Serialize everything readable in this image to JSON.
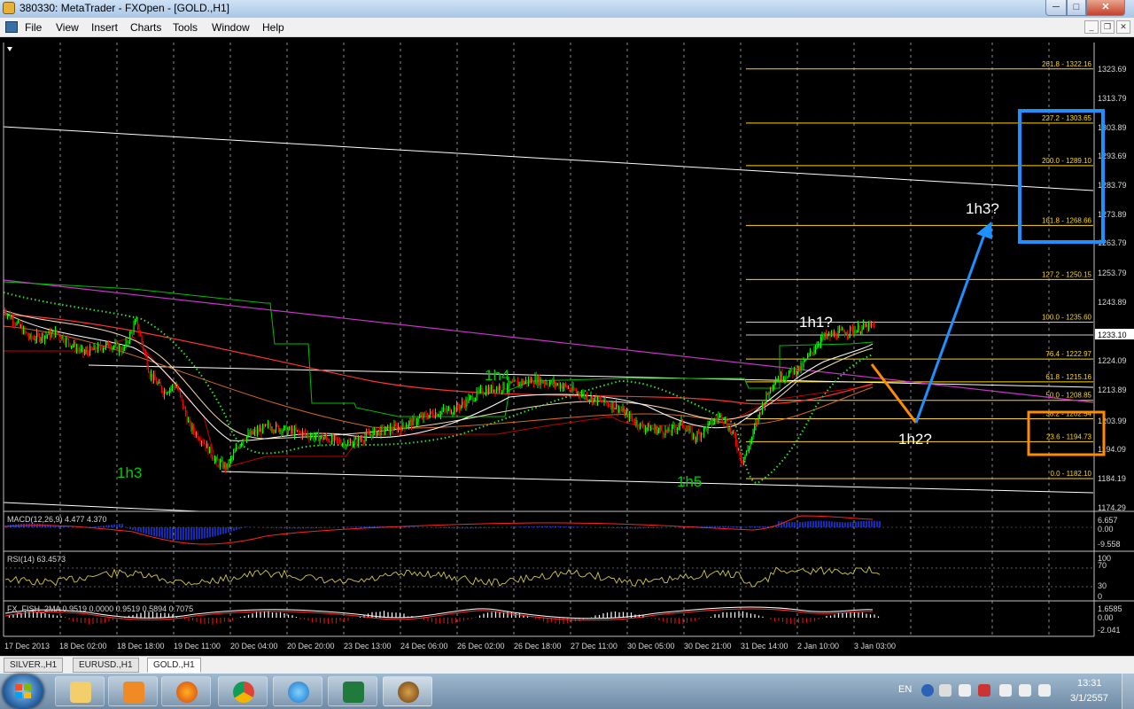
{
  "window": {
    "title": "380330: MetaTrader - FXOpen - [GOLD.,H1]",
    "min_glyph": "─",
    "max_glyph": "□",
    "close_glyph": "✕"
  },
  "menu": [
    "File",
    "View",
    "Insert",
    "Charts",
    "Tools",
    "Window",
    "Help"
  ],
  "mdi": {
    "min": "_",
    "restore": "❐",
    "close": "✕"
  },
  "chart_data": {
    "type": "candlestick",
    "symbol": "GOLD.,H1",
    "price_axis": [
      "1323.69",
      "1313.79",
      "1303.89",
      "1293.69",
      "1283.79",
      "1273.89",
      "1263.79",
      "1253.79",
      "1243.89",
      "1233.10",
      "1224.09",
      "1213.89",
      "1203.99",
      "1194.09",
      "1184.19",
      "1174.29"
    ],
    "current_price": "1233.10",
    "time_axis": [
      "17 Dec 2013",
      "18 Dec 02:00",
      "18 Dec 18:00",
      "19 Dec 11:00",
      "20 Dec 04:00",
      "20 Dec 20:00",
      "23 Dec 13:00",
      "24 Dec 06:00",
      "26 Dec 02:00",
      "26 Dec 18:00",
      "27 Dec 11:00",
      "30 Dec 05:00",
      "30 Dec 21:00",
      "31 Dec 14:00",
      "2 Jan 10:00",
      "3 Jan 03:00"
    ],
    "fibonacci": [
      {
        "label": "261.8 - 1322.16"
      },
      {
        "label": "227.2 - 1303.65"
      },
      {
        "label": "200.0 - 1289.10"
      },
      {
        "label": "161.8 - 1268.66"
      },
      {
        "label": "127.2 - 1250.15"
      },
      {
        "label": "100.0 - 1235.60"
      },
      {
        "label": "76.4 - 1222.97"
      },
      {
        "label": "61.8 - 1215.16"
      },
      {
        "label": "50.0 - 1208.85"
      },
      {
        "label": "38.2 - 1202.54"
      },
      {
        "label": "23.6 - 1194.73"
      },
      {
        "label": "0.0 - 1182.10"
      }
    ],
    "wave_labels": [
      {
        "text": "1h3",
        "color": "#00ff00"
      },
      {
        "text": "1h4",
        "color": "#00ff00"
      },
      {
        "text": "1h5",
        "color": "#00ff00"
      },
      {
        "text": "1h1?",
        "color": "#ffffff"
      },
      {
        "text": "1h2?",
        "color": "#ffffff"
      },
      {
        "text": "1h3?",
        "color": "#ffffff"
      }
    ],
    "indicators": {
      "macd": {
        "title": "MACD(12,26,9) 4.477 4.370",
        "axis": [
          "6.657",
          "0.00",
          "-9.558"
        ]
      },
      "rsi": {
        "title": "RSI(14) 63.4573",
        "axis": [
          "100",
          "70",
          "30",
          "0"
        ]
      },
      "fish": {
        "title": "FX_FISH_2MA 0.9519 0.0000 0.9519 0.5894 0.7075",
        "axis": [
          "1.6585",
          "0.00",
          "-2.041"
        ]
      }
    },
    "colors": {
      "bull": "#00ff00",
      "bear": "#ff0000",
      "fib": "#ffd700",
      "blue_box": "#1e90ff",
      "orange_box": "#ff8c00"
    }
  },
  "tabs": [
    "SILVER.,H1",
    "EURUSD.,H1",
    "GOLD.,H1"
  ],
  "active_tab": "GOLD.,H1",
  "taskbar": {
    "apps": [
      "file-explorer",
      "media-player",
      "firefox",
      "chrome",
      "internet-explorer",
      "excel",
      "metatrader"
    ],
    "language": "EN",
    "time": "13:31",
    "date": "3/1/2557"
  }
}
